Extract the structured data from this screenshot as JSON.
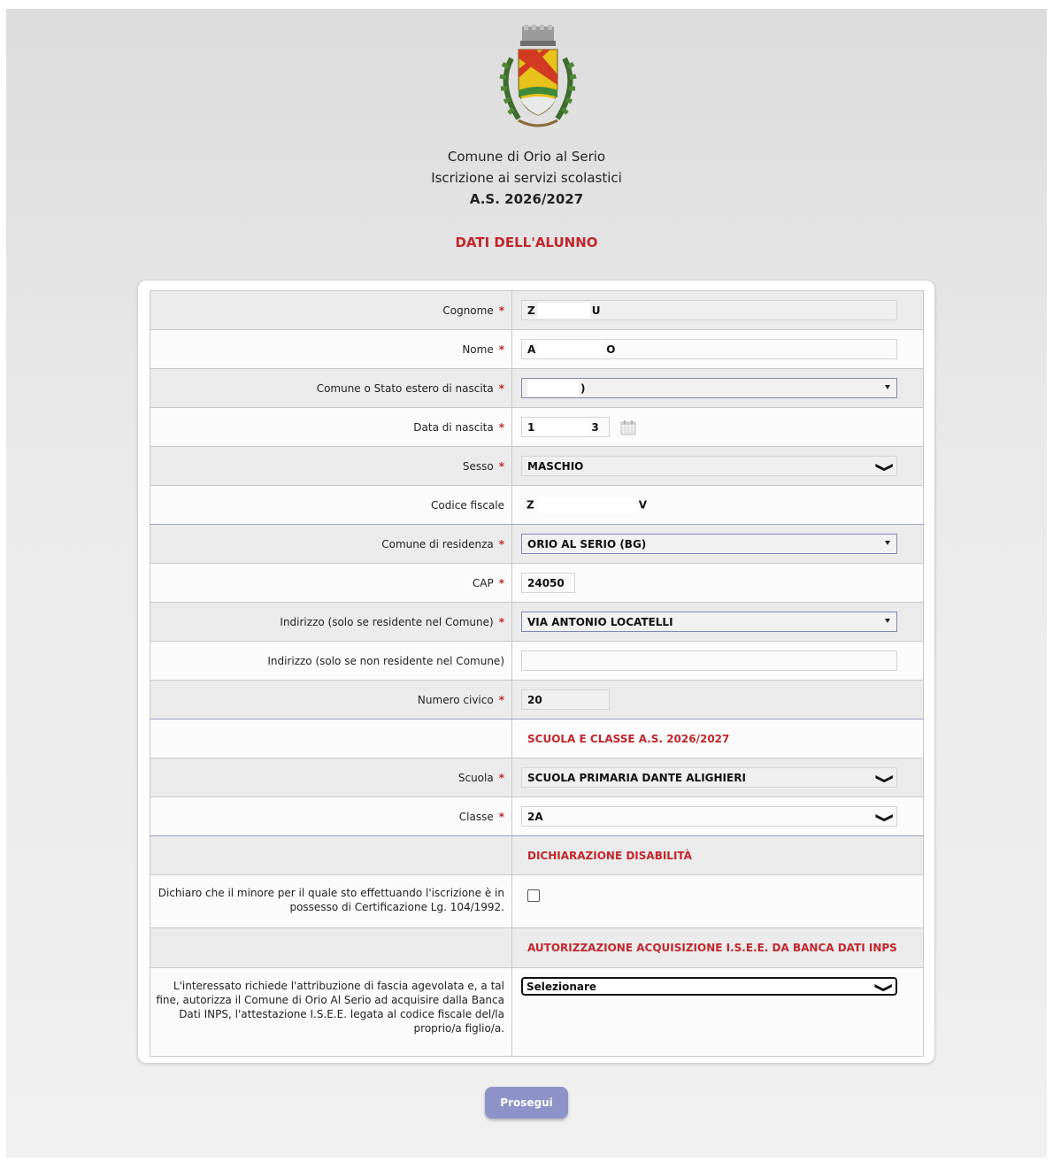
{
  "header": {
    "comune": "Comune di Orio al Serio",
    "servizi": "Iscrizione ai servizi scolastici",
    "anno": "A.S. 2026/2027",
    "section_title": "DATI DELL'ALUNNO"
  },
  "form": {
    "cognome": {
      "label": "Cognome",
      "value_start": "Z",
      "value_end": "U"
    },
    "nome": {
      "label": "Nome",
      "value_start": "A",
      "value_end": "O"
    },
    "comune_nascita": {
      "label": "Comune o Stato estero di nascita",
      "value_start": "",
      "value_end": ")"
    },
    "data_nascita": {
      "label": "Data di nascita",
      "value_start": "1",
      "value_end": "3"
    },
    "sesso": {
      "label": "Sesso",
      "value": "MASCHIO"
    },
    "codice_fiscale": {
      "label": "Codice fiscale",
      "value_start": "Z",
      "value_end": "V"
    },
    "comune_residenza": {
      "label": "Comune di residenza",
      "value": "ORIO AL SERIO (BG)"
    },
    "cap": {
      "label": "CAP",
      "value": "24050"
    },
    "indirizzo_residente": {
      "label": "Indirizzo (solo se residente nel Comune)",
      "value": "VIA ANTONIO LOCATELLI"
    },
    "indirizzo_non_residente": {
      "label": "Indirizzo (solo se non residente nel Comune)",
      "value": ""
    },
    "numero_civico": {
      "label": "Numero civico",
      "value": "20"
    },
    "scuola_section": "SCUOLA E CLASSE A.S. 2026/2027",
    "scuola": {
      "label": "Scuola",
      "value": "SCUOLA PRIMARIA DANTE ALIGHIERI"
    },
    "classe": {
      "label": "Classe",
      "value": "2A"
    },
    "disabilita_section": "DICHIARAZIONE DISABILITÀ",
    "disabilita": {
      "label": "Dichiaro che il minore per il quale sto effettuando l'iscrizione è in possesso di Certificazione Lg. 104/1992.",
      "checked": false
    },
    "isee_section": "AUTORIZZAZIONE ACQUISIZIONE I.S.E.E. DA BANCA DATI INPS",
    "isee": {
      "label": "L'interessato richiede l'attribuzione di fascia agevolata e, a tal fine, autorizza il Comune di Orio Al Serio ad acquisire dalla Banca Dati INPS, l'attestazione I.S.E.E. legata al codice fiscale del/la proprio/a figlio/a.",
      "value": "Selezionare"
    }
  },
  "required_mark": "*",
  "buttons": {
    "prosegui": "Prosegui"
  },
  "icons": {
    "calendar": "calendar-icon",
    "dropdown": "chevron-down-icon",
    "logo": "coat-of-arms"
  },
  "colors": {
    "accent_red": "#c0272d",
    "button": "#8d93c9"
  }
}
